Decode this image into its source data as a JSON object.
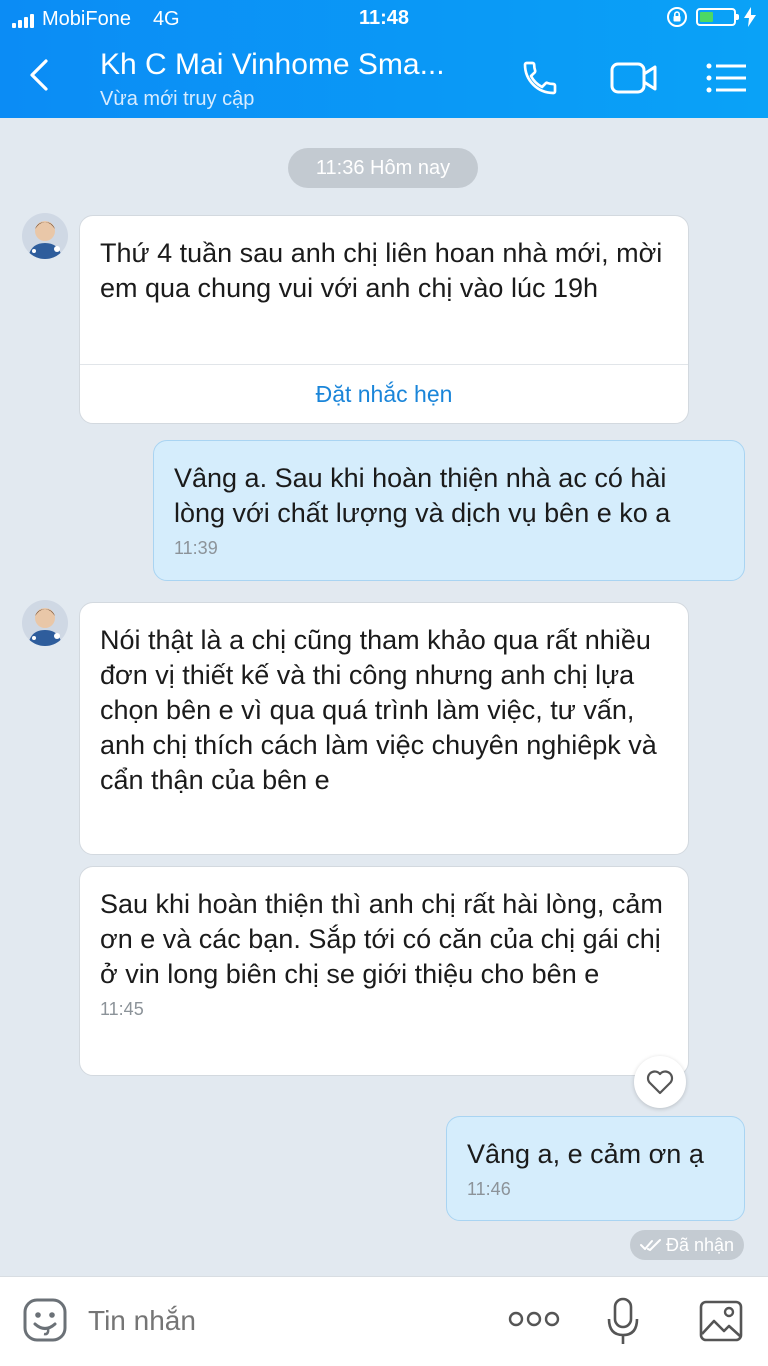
{
  "status_bar": {
    "carrier": "MobiFone",
    "network": "4G",
    "time": "11:48"
  },
  "header": {
    "title": "Kh C Mai Vinhome Sma...",
    "subtitle": "Vừa mới truy cập"
  },
  "date_chip": "11:36 Hôm nay",
  "messages": [
    {
      "direction": "in",
      "text": "Thứ 4 tuần sau anh chị liên hoan nhà mới, mời em qua chung vui với anh chị vào lúc 19h",
      "action": "Đặt nhắc hẹn"
    },
    {
      "direction": "out",
      "text": "Vâng a. Sau khi hoàn thiện nhà ac có hài lòng với chất lượng và dịch vụ bên e ko a",
      "time": "11:39"
    },
    {
      "direction": "in",
      "text": "Nói thật là a chị cũng tham khảo qua rất nhiều đơn vị thiết kế và thi công nhưng anh chị lựa chọn bên e vì qua quá trình làm việc, tư vấn, anh chị thích cách làm việc chuyên nghiêpk  và cẩn thận của bên e"
    },
    {
      "direction": "in",
      "text": "Sau khi hoàn thiện thì anh chị rất hài lòng, cảm ơn e và các bạn. Sắp tới có căn của chị gái chị ở vin long biên chị se giới thiệu cho bên e",
      "time": "11:45"
    },
    {
      "direction": "out",
      "text": "Vâng a, e cảm ơn ạ",
      "time": "11:46"
    }
  ],
  "delivery_status": "Đã nhận",
  "input": {
    "placeholder": "Tin nhắn"
  },
  "colors": {
    "header": "#0b8cf5",
    "incoming_bubble": "#ffffff",
    "outgoing_bubble": "#d5edfc",
    "background": "#e2e9f0",
    "link": "#1a85d9"
  },
  "icons": [
    "back-icon",
    "phone-icon",
    "video-call-icon",
    "menu-icon",
    "sticker-icon",
    "more-icon",
    "microphone-icon",
    "image-icon",
    "heart-icon",
    "double-check-icon"
  ]
}
